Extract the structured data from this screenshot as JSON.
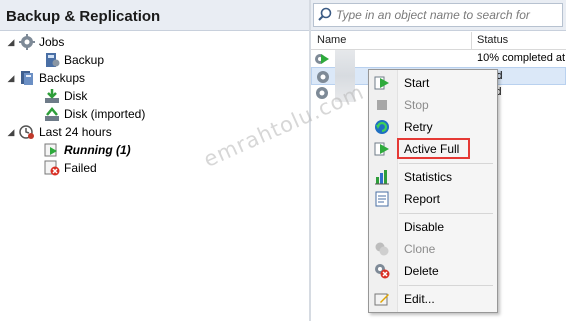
{
  "left_pane": {
    "title": "Backup & Replication",
    "tree": {
      "jobs": {
        "label": "Jobs",
        "children": [
          {
            "label": "Backup"
          }
        ]
      },
      "backups": {
        "label": "Backups",
        "children": [
          {
            "label": "Disk"
          },
          {
            "label": "Disk (imported)"
          }
        ]
      },
      "last24": {
        "label": "Last 24 hours",
        "children": [
          {
            "label": "Running (1)"
          },
          {
            "label": "Failed"
          }
        ]
      }
    }
  },
  "right_pane": {
    "search_placeholder": "Type in an object name to search for",
    "columns": {
      "name": "Name",
      "status": "Status"
    },
    "rows": [
      {
        "status": "10% completed at"
      },
      {
        "status": "pped"
      },
      {
        "status": "pped"
      }
    ]
  },
  "context_menu": {
    "items": {
      "start": "Start",
      "stop": "Stop",
      "retry": "Retry",
      "active_full": "Active Full",
      "statistics": "Statistics",
      "report": "Report",
      "disable": "Disable",
      "clone": "Clone",
      "delete": "Delete",
      "edit": "Edit..."
    },
    "highlight_color": "#e53935"
  },
  "watermark": "emrahtolu.com",
  "icons": {
    "jobs": "gear-icon",
    "backup_job": "backup-job-icon",
    "backups": "backups-icon",
    "disk": "disk-icon",
    "last24": "history-icon",
    "running": "running-icon",
    "failed": "failed-icon",
    "search": "search-icon"
  }
}
